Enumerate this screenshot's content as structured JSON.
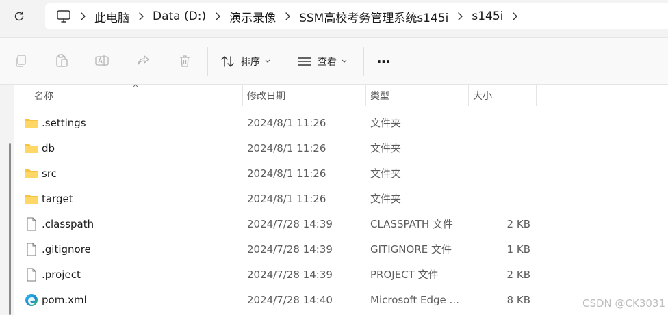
{
  "address": {
    "refresh_icon": "refresh-icon",
    "pc_icon": "monitor-icon",
    "crumbs": [
      "此电脑",
      "Data (D:)",
      "演示录像",
      "SSM高校考务管理系统s145i",
      "s145i"
    ]
  },
  "toolbar": {
    "copy_icon": "copy-icon",
    "paste_icon": "paste-icon",
    "rename_icon": "rename-icon",
    "share_icon": "share-icon",
    "delete_icon": "delete-icon",
    "sort_label": "排序",
    "view_label": "查看",
    "more_label": "···"
  },
  "columns": {
    "name": "名称",
    "date": "修改日期",
    "type": "类型",
    "size": "大小"
  },
  "files": [
    {
      "name": ".settings",
      "date": "2024/8/1 11:26",
      "type": "文件夹",
      "size": "",
      "icon": "folder-icon"
    },
    {
      "name": "db",
      "date": "2024/8/1 11:26",
      "type": "文件夹",
      "size": "",
      "icon": "folder-icon"
    },
    {
      "name": "src",
      "date": "2024/8/1 11:26",
      "type": "文件夹",
      "size": "",
      "icon": "folder-icon"
    },
    {
      "name": "target",
      "date": "2024/8/1 11:26",
      "type": "文件夹",
      "size": "",
      "icon": "folder-icon"
    },
    {
      "name": ".classpath",
      "date": "2024/7/28 14:39",
      "type": "CLASSPATH 文件",
      "size": "2 KB",
      "icon": "file-icon"
    },
    {
      "name": ".gitignore",
      "date": "2024/7/28 14:39",
      "type": "GITIGNORE 文件",
      "size": "1 KB",
      "icon": "file-icon"
    },
    {
      "name": ".project",
      "date": "2024/7/28 14:39",
      "type": "PROJECT 文件",
      "size": "2 KB",
      "icon": "file-icon"
    },
    {
      "name": "pom.xml",
      "date": "2024/7/28 14:40",
      "type": "Microsoft Edge ...",
      "size": "8 KB",
      "icon": "edge-icon"
    }
  ],
  "watermark": "CSDN @CK3031",
  "colors": {
    "folder": "#f6c342",
    "accent": "#0067c0"
  }
}
